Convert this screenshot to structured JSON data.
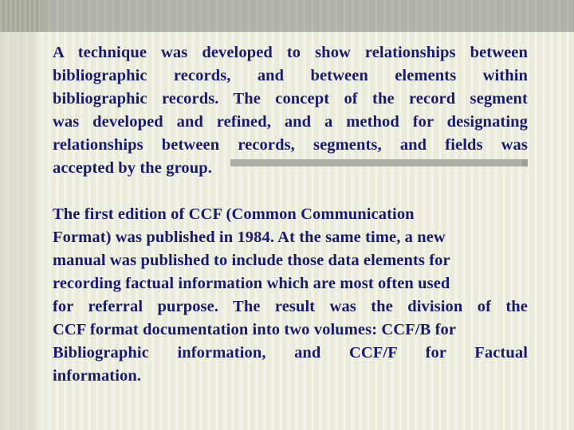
{
  "slide": {
    "title_text_color": "#191970",
    "background_color": "#eef0e2",
    "top_band_color": "#b2b3ab",
    "left_band_color": "#dfe0d4",
    "rule_color": "#adaea6",
    "paragraphs": [
      {
        "id": "paragraph-1",
        "lines": [
          "A technique was developed to show relationships between",
          "bibliographic records, and between elements within",
          "bibliographic records. The concept of the record segment",
          "was developed and refined, and a method for designating",
          "relationships between records, segments, and fields was",
          "accepted by the group."
        ],
        "full_text": "A technique was developed to show relationships between bibliographic records, and between elements within bibliographic records. The concept of the record segment was developed and refined, and a method for designating relationships between records, segments, and fields was accepted by the group."
      },
      {
        "id": "paragraph-2",
        "lines": [
          "The first edition of CCF (Common Communication",
          "Format) was published in 1984. At the same time, a new",
          "manual was published to include those data elements for",
          "recording factual information which are most often used",
          "for referral purpose. The result was the division of the",
          "CCF format documentation into two volumes: CCF/B for",
          "Bibliographic information, and CCF/F for Factual",
          "information."
        ],
        "full_text": "The first edition of CCF (Common Communication Format) was published in 1984. At the same time, a new manual was published to include those data elements for recording factual information which are most often used for referral purpose. The result was the division of the CCF format documentation into two volumes: CCF/B for Bibliographic information, and CCF/F for Factual information."
      }
    ]
  }
}
